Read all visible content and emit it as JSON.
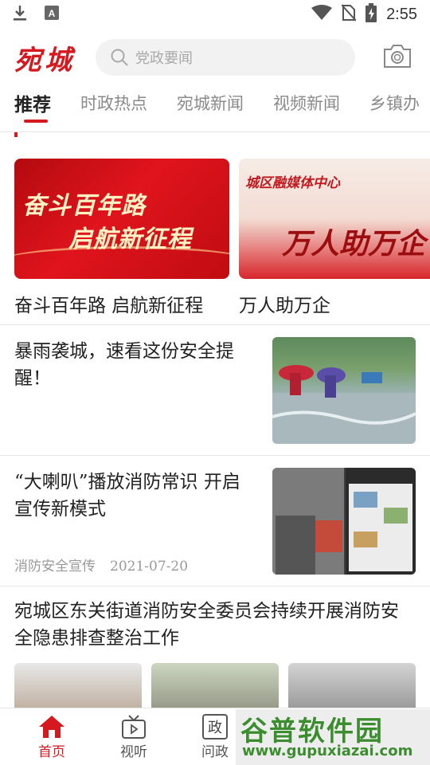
{
  "status_bar": {
    "time": "2:55"
  },
  "header": {
    "logo": "宛城",
    "search_placeholder": "党政要闻"
  },
  "tabs": [
    {
      "label": "推荐",
      "active": true
    },
    {
      "label": "时政热点",
      "active": false
    },
    {
      "label": "宛城新闻",
      "active": false
    },
    {
      "label": "视频新闻",
      "active": false
    },
    {
      "label": "乡镇办",
      "active": false
    }
  ],
  "carousel": [
    {
      "caption": "奋斗百年路 启航新征程",
      "image_text_1": "奋斗百年路",
      "image_text_2": "启航新征程"
    },
    {
      "caption": "万人助万企",
      "image_text_1": "城区融媒体中心",
      "image_text_2": "万人助万企"
    }
  ],
  "news": [
    {
      "title": "暴雨袭城，速看这份安全提醒！"
    },
    {
      "title": "“大喇叭”播放消防常识  开启宣传新模式",
      "source": "消防安全宣传",
      "date": "2021-07-20"
    },
    {
      "title": "宛城区东关街道消防安全委员会持续开展消防安全隐患排查整治工作"
    }
  ],
  "bottom_nav": [
    {
      "label": "首页",
      "icon": "home-icon",
      "active": true
    },
    {
      "label": "视听",
      "icon": "tv-icon",
      "active": false
    },
    {
      "label": "问政",
      "icon": "zheng-icon",
      "active": false
    }
  ],
  "watermark": {
    "line1": "谷普软件园",
    "line2": "www.gupuxiazai.com"
  },
  "colors": {
    "accent": "#d6181f"
  }
}
